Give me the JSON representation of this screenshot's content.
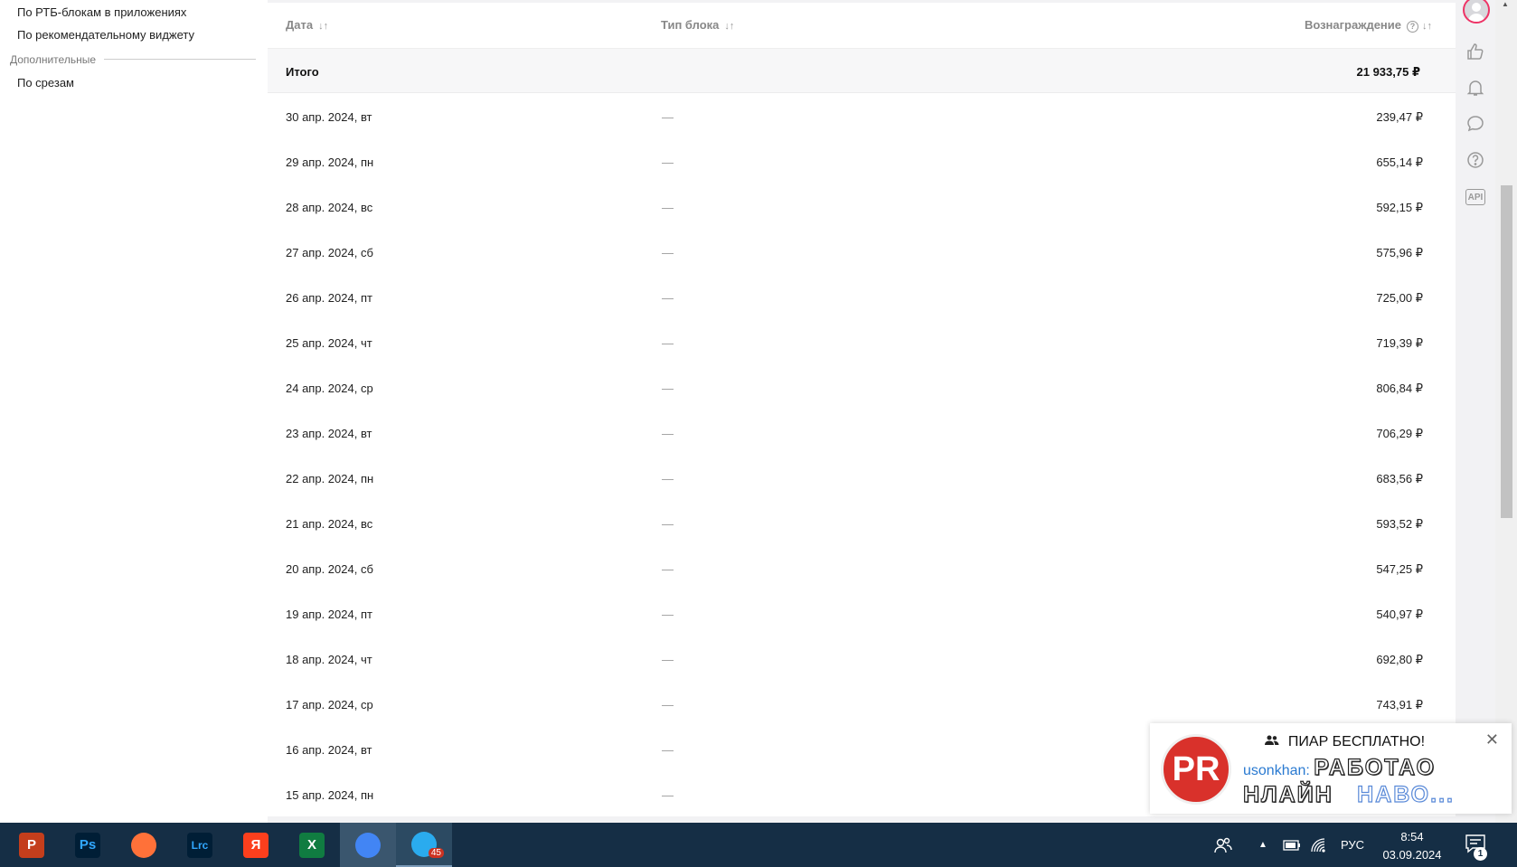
{
  "sidebar": {
    "links": [
      "По РТБ-блокам в приложениях",
      "По рекомендательному виджету"
    ],
    "section_label": "Дополнительные",
    "extra_links": [
      "По срезам"
    ]
  },
  "table": {
    "columns": {
      "date": "Дата",
      "block_type": "Тип блока",
      "reward": "Вознаграждение"
    },
    "sort_glyph": "↓↑",
    "help_glyph": "?",
    "total": {
      "label": "Итого",
      "reward": "21 933,75 ₽"
    },
    "rows": [
      {
        "date": "30 апр. 2024, вт",
        "type": "—",
        "reward": "239,47 ₽"
      },
      {
        "date": "29 апр. 2024, пн",
        "type": "—",
        "reward": "655,14 ₽"
      },
      {
        "date": "28 апр. 2024, вс",
        "type": "—",
        "reward": "592,15 ₽"
      },
      {
        "date": "27 апр. 2024, сб",
        "type": "—",
        "reward": "575,96 ₽"
      },
      {
        "date": "26 апр. 2024, пт",
        "type": "—",
        "reward": "725,00 ₽"
      },
      {
        "date": "25 апр. 2024, чт",
        "type": "—",
        "reward": "719,39 ₽"
      },
      {
        "date": "24 апр. 2024, ср",
        "type": "—",
        "reward": "806,84 ₽"
      },
      {
        "date": "23 апр. 2024, вт",
        "type": "—",
        "reward": "706,29 ₽"
      },
      {
        "date": "22 апр. 2024, пн",
        "type": "—",
        "reward": "683,56 ₽"
      },
      {
        "date": "21 апр. 2024, вс",
        "type": "—",
        "reward": "593,52 ₽"
      },
      {
        "date": "20 апр. 2024, сб",
        "type": "—",
        "reward": "547,25 ₽"
      },
      {
        "date": "19 апр. 2024, пт",
        "type": "—",
        "reward": "540,97 ₽"
      },
      {
        "date": "18 апр. 2024, чт",
        "type": "—",
        "reward": "692,80 ₽"
      },
      {
        "date": "17 апр. 2024, ср",
        "type": "—",
        "reward": "743,91 ₽"
      },
      {
        "date": "16 апр. 2024, вт",
        "type": "—",
        "reward": ""
      },
      {
        "date": "15 апр. 2024, пн",
        "type": "—",
        "reward": ""
      }
    ]
  },
  "rail": {
    "icons": [
      "avatar",
      "thumbs-up-icon",
      "bell-icon",
      "chat-icon",
      "help-icon",
      "api-icon"
    ],
    "api_label": "API"
  },
  "toast": {
    "logo": "PR",
    "title": "ПИАР БЕСПЛАТНО!",
    "author": "usonkhan:",
    "big_text_1": "РАБОТАО",
    "big_text_2": "НЛАЙН",
    "big_text_3": "НАВО...",
    "close": "✕"
  },
  "taskbar": {
    "apps": [
      {
        "name": "powerpoint",
        "glyph": "P",
        "color": "#c43e1c"
      },
      {
        "name": "photoshop",
        "glyph": "Ps",
        "color": "#001e36"
      },
      {
        "name": "firefox",
        "glyph": "",
        "color": "#ff7139"
      },
      {
        "name": "lightroom",
        "glyph": "Lrc",
        "color": "#001e36"
      },
      {
        "name": "yandex",
        "glyph": "Я",
        "color": "#fc3f1d"
      },
      {
        "name": "excel",
        "glyph": "X",
        "color": "#107c41"
      },
      {
        "name": "chrome",
        "glyph": "",
        "color": "#4285f4"
      },
      {
        "name": "telegram",
        "glyph": "",
        "color": "#2aabee"
      }
    ],
    "telegram_badge": "45",
    "language": "РУС",
    "time": "8:54",
    "date": "03.09.2024",
    "notification_count": "1"
  }
}
